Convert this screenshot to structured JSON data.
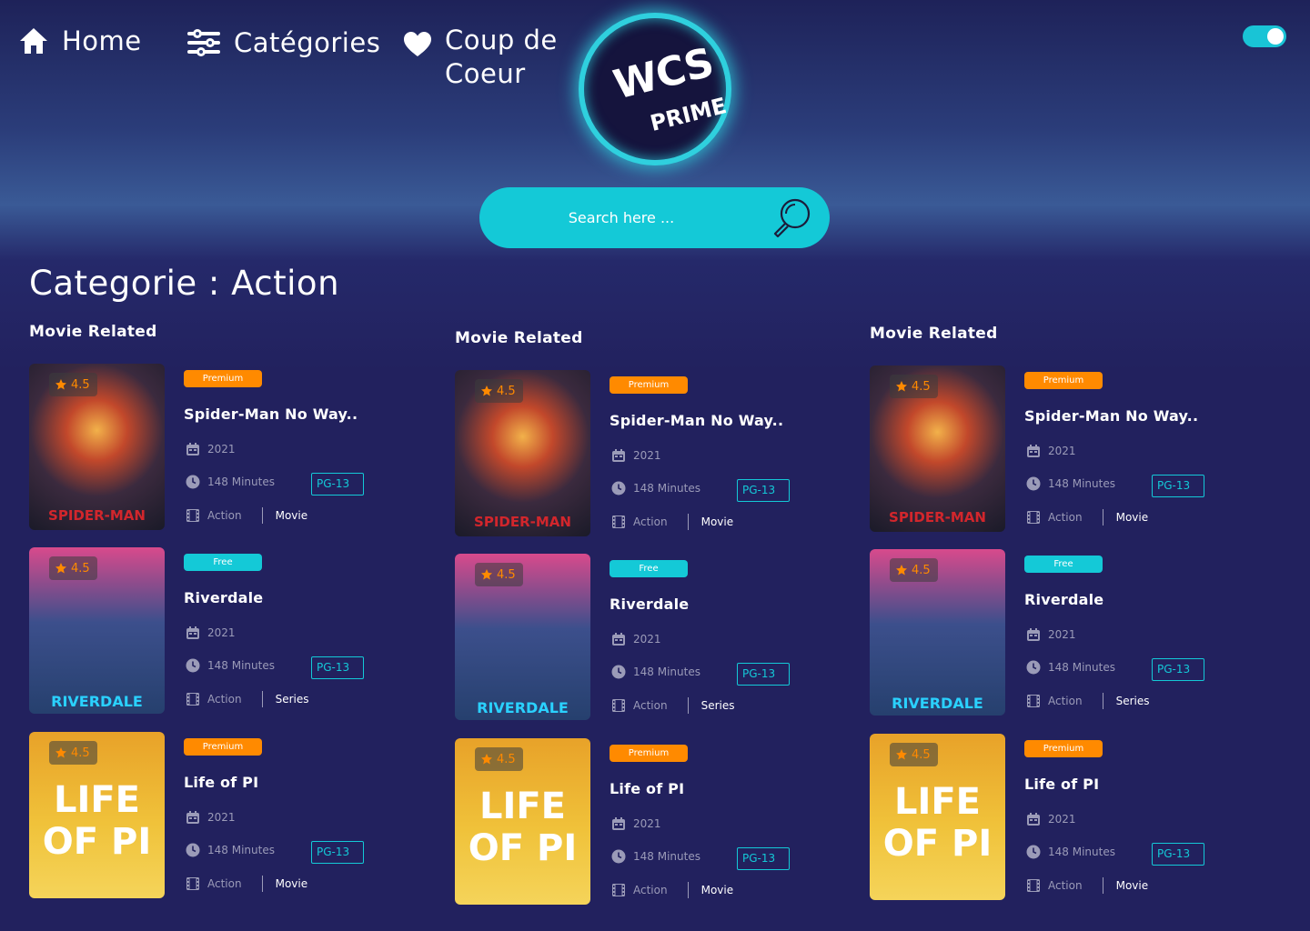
{
  "nav": {
    "home": "Home",
    "categories": "Catégories",
    "favorites_line1": "Coup de",
    "favorites_line2": "Coeur"
  },
  "logo": {
    "line1": "WCS",
    "line2": "PRIME"
  },
  "search": {
    "placeholder": "Search here ..."
  },
  "page_title": "Categorie : Action",
  "columns": [
    {
      "title": "Movie Related",
      "cards": [
        {
          "rating": "4.5",
          "badge": "Premium",
          "title": "Spider-Man No Way..",
          "year": "2021",
          "duration": "148 Minutes",
          "certificate": "PG-13",
          "genre": "Action",
          "type": "Movie",
          "poster_text": "SPIDER-MAN"
        },
        {
          "rating": "4.5",
          "badge": "Free",
          "title": "Riverdale",
          "year": "2021",
          "duration": "148 Minutes",
          "certificate": "PG-13",
          "genre": "Action",
          "type": "Series",
          "poster_text": "RIVERDALE"
        },
        {
          "rating": "4.5",
          "badge": "Premium",
          "title": "Life of PI",
          "year": "2021",
          "duration": "148 Minutes",
          "certificate": "PG-13",
          "genre": "Action",
          "type": "Movie",
          "poster_text": "LIFE OF PI"
        }
      ]
    },
    {
      "title": "Movie Related",
      "cards": [
        {
          "rating": "4.5",
          "badge": "Premium",
          "title": "Spider-Man No Way..",
          "year": "2021",
          "duration": "148 Minutes",
          "certificate": "PG-13",
          "genre": "Action",
          "type": "Movie",
          "poster_text": "SPIDER-MAN"
        },
        {
          "rating": "4.5",
          "badge": "Free",
          "title": "Riverdale",
          "year": "2021",
          "duration": "148 Minutes",
          "certificate": "PG-13",
          "genre": "Action",
          "type": "Series",
          "poster_text": "RIVERDALE"
        },
        {
          "rating": "4.5",
          "badge": "Premium",
          "title": "Life of PI",
          "year": "2021",
          "duration": "148 Minutes",
          "certificate": "PG-13",
          "genre": "Action",
          "type": "Movie",
          "poster_text": "LIFE OF PI"
        }
      ]
    },
    {
      "title": "Movie Related",
      "cards": [
        {
          "rating": "4.5",
          "badge": "Premium",
          "title": "Spider-Man No Way..",
          "year": "2021",
          "duration": "148 Minutes",
          "certificate": "PG-13",
          "genre": "Action",
          "type": "Movie",
          "poster_text": "SPIDER-MAN"
        },
        {
          "rating": "4.5",
          "badge": "Free",
          "title": "Riverdale",
          "year": "2021",
          "duration": "148 Minutes",
          "certificate": "PG-13",
          "genre": "Action",
          "type": "Series",
          "poster_text": "RIVERDALE"
        },
        {
          "rating": "4.5",
          "badge": "Premium",
          "title": "Life of PI",
          "year": "2021",
          "duration": "148 Minutes",
          "certificate": "PG-13",
          "genre": "Action",
          "type": "Movie",
          "poster_text": "LIFE OF PI"
        }
      ]
    }
  ],
  "theme": {
    "accent": "#14c9d7",
    "premium": "#ff8a00",
    "background": "#22215e"
  },
  "toggle": {
    "on": true
  }
}
